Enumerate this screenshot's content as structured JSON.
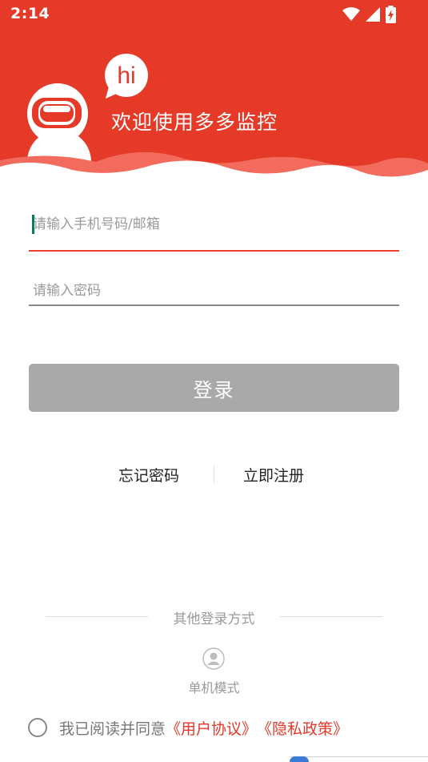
{
  "status_bar": {
    "time": "2:14",
    "icons": [
      "wifi-icon",
      "signal-icon",
      "battery-charging-icon"
    ]
  },
  "header": {
    "welcome": "欢迎使用多多监控",
    "bubble_text": "hi",
    "color": "#e43a27",
    "wave_color": "#f36b5c"
  },
  "form": {
    "phone_placeholder": "请输入手机号码/邮箱",
    "phone_value": "",
    "password_placeholder": "请输入密码",
    "password_value": "",
    "login_label": "登录"
  },
  "links": {
    "forgot": "忘记密码",
    "register": "立即注册"
  },
  "other_login": {
    "title": "其他登录方式",
    "single_mode": "单机模式",
    "icon": "user-icon"
  },
  "agreement": {
    "prefix": "我已阅读并同意",
    "user_agreement": "《用户协议》",
    "privacy": "《隐私政策》",
    "checked": false
  }
}
